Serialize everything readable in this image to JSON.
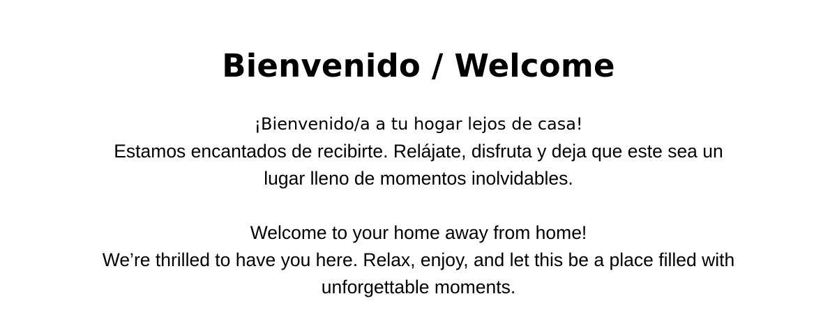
{
  "page": {
    "title": "Bienvenido / Welcome"
  },
  "spanish": {
    "greeting": "¡Bienvenido/a a tu hogar lejos de casa!",
    "line1": "Estamos encantados de recibirte. Relájate, disfruta y deja que este sea un",
    "line2": "lugar lleno de momentos inolvidables."
  },
  "english": {
    "greeting": "Welcome to your home away from home!",
    "line1": "We’re thrilled to have you here. Relax, enjoy, and let this be a place filled with",
    "line2": "unforgettable moments."
  },
  "colors": {
    "background": "#ffffff",
    "text": "#000000"
  }
}
